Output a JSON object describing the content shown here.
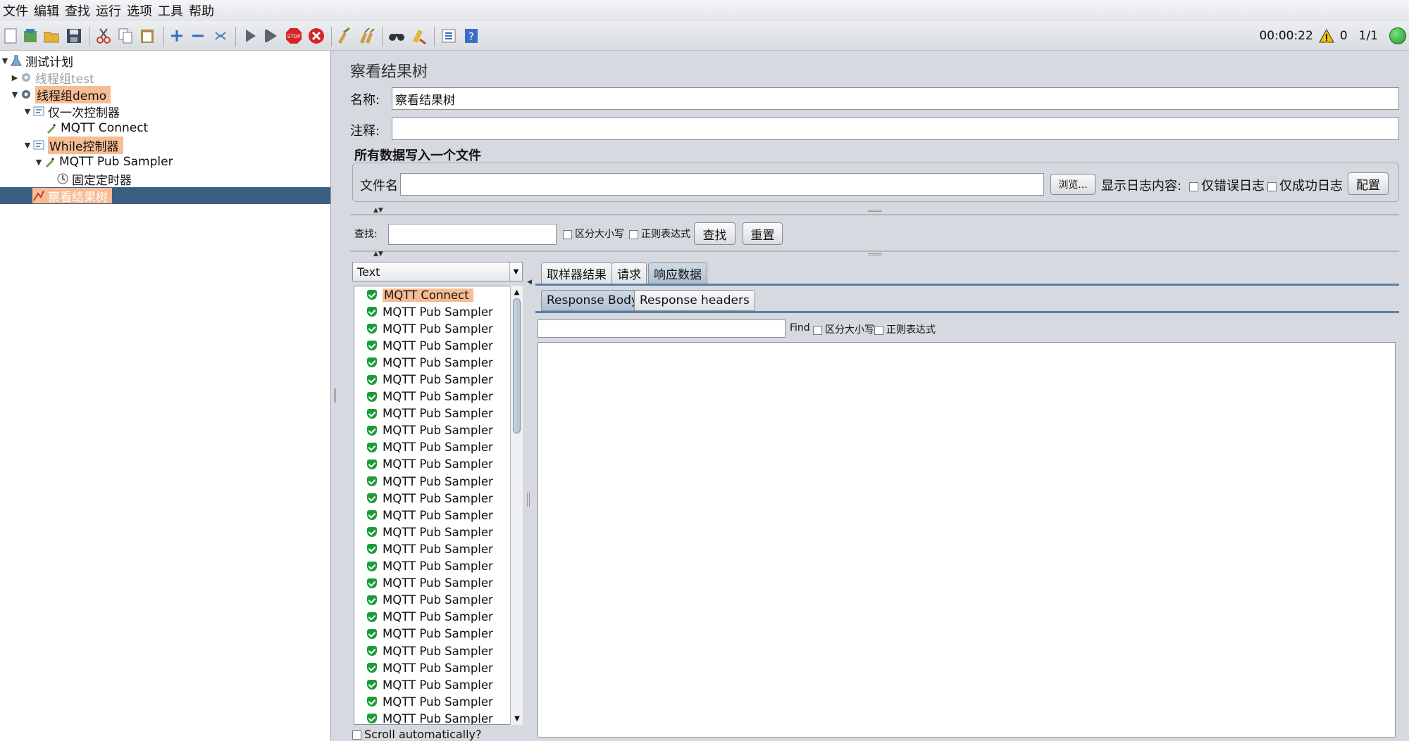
{
  "menu": [
    "文件",
    "编辑",
    "查找",
    "运行",
    "选项",
    "工具",
    "帮助"
  ],
  "status": {
    "timer": "00:00:22",
    "warnings": "0",
    "threads": "1/1",
    "running_color": "#2db33a"
  },
  "tree": {
    "items": [
      {
        "label": "测试计划",
        "depth": 0,
        "tri": "▼",
        "highlight": false,
        "icon": "flask-icon"
      },
      {
        "label": "线程组test",
        "depth": 1,
        "tri": "▶",
        "highlight": false,
        "icon": "gear-icon",
        "disabled": true
      },
      {
        "label": "线程组demo",
        "depth": 1,
        "tri": "▼",
        "highlight": true,
        "icon": "gear-icon"
      },
      {
        "label": "仅一次控制器",
        "depth": 2,
        "tri": "▼",
        "highlight": false,
        "icon": "controller-icon"
      },
      {
        "label": "MQTT Connect",
        "depth": 3,
        "tri": "",
        "highlight": false,
        "icon": "pipette-icon"
      },
      {
        "label": "While控制器",
        "depth": 2,
        "tri": "▼",
        "highlight": true,
        "icon": "controller-icon"
      },
      {
        "label": "MQTT Pub Sampler",
        "depth": 3,
        "tri": "▼",
        "highlight": false,
        "icon": "pipette-icon"
      },
      {
        "label": "固定定时器",
        "depth": 4,
        "tri": "",
        "highlight": false,
        "icon": "clock-icon"
      },
      {
        "label": "察看结果树",
        "depth": 2,
        "tri": "",
        "highlight": false,
        "icon": "chart-icon",
        "selected": true
      }
    ]
  },
  "panel": {
    "title": "察看结果树",
    "name_label": "名称:",
    "name_value": "察看结果树",
    "comment_label": "注释:",
    "comment_value": "",
    "file_section": "所有数据写入一个文件",
    "file_label": "文件名",
    "file_value": "",
    "browse": "浏览...",
    "log_label": "显示日志内容:",
    "errors_only": "仅错误日志",
    "success_only": "仅成功日志",
    "configure": "配置"
  },
  "search": {
    "label": "查找:",
    "value": "",
    "case": "区分大小写",
    "regex": "正则表达式",
    "find": "查找",
    "reset": "重置"
  },
  "renderer": "Text",
  "results": [
    "MQTT Connect",
    "MQTT Pub Sampler",
    "MQTT Pub Sampler",
    "MQTT Pub Sampler",
    "MQTT Pub Sampler",
    "MQTT Pub Sampler",
    "MQTT Pub Sampler",
    "MQTT Pub Sampler",
    "MQTT Pub Sampler",
    "MQTT Pub Sampler",
    "MQTT Pub Sampler",
    "MQTT Pub Sampler",
    "MQTT Pub Sampler",
    "MQTT Pub Sampler",
    "MQTT Pub Sampler",
    "MQTT Pub Sampler",
    "MQTT Pub Sampler",
    "MQTT Pub Sampler",
    "MQTT Pub Sampler",
    "MQTT Pub Sampler",
    "MQTT Pub Sampler",
    "MQTT Pub Sampler",
    "MQTT Pub Sampler",
    "MQTT Pub Sampler",
    "MQTT Pub Sampler",
    "MQTT Pub Sampler"
  ],
  "scroll_auto": "Scroll automatically?",
  "tabs": [
    "取样器结果",
    "请求",
    "响应数据"
  ],
  "subtabs": [
    "Response Body",
    "Response headers"
  ],
  "resp_find": {
    "label": "Find",
    "case": "区分大小写",
    "regex": "正则表达式",
    "value": ""
  },
  "colors": {
    "highlight": "#f7bc93",
    "selected_row": "#3a5f82",
    "success": "#1a9d36"
  }
}
